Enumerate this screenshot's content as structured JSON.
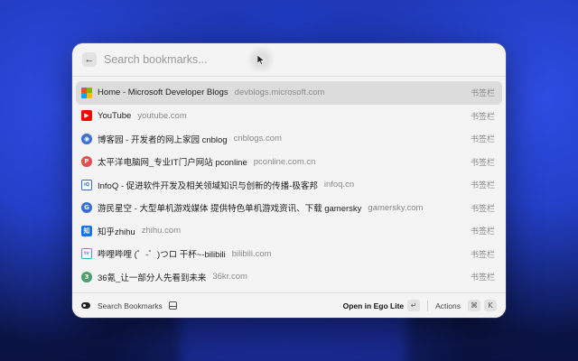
{
  "search": {
    "placeholder": "Search bookmarks..."
  },
  "bookmarks": [
    {
      "title": "Home - Microsoft Developer Blogs",
      "url": "devblogs.microsoft.com",
      "tag": "书签栏",
      "icon": "microsoft-icon",
      "color": "#f25022"
    },
    {
      "title": "YouTube",
      "url": "youtube.com",
      "tag": "书签栏",
      "icon": "youtube-icon",
      "color": "#ff0000"
    },
    {
      "title": "博客园 - 开发者的网上家园 cnblog",
      "url": "cnblogs.com",
      "tag": "书签栏",
      "icon": "cnblogs-icon",
      "color": "#3b6fd4"
    },
    {
      "title": "太平洋电脑网_专业IT门户网站 pconline",
      "url": "pconline.com.cn",
      "tag": "书签栏",
      "icon": "pconline-icon",
      "color": "#e84c4c"
    },
    {
      "title": "InfoQ - 促进软件开发及相关领域知识与创新的传播-极客邦",
      "url": "infoq.cn",
      "tag": "书签栏",
      "icon": "infoq-icon",
      "color": "#2d6fd6"
    },
    {
      "title": "游民星空 - 大型单机游戏媒体 提供特色单机游戏资讯、下载 gamersky",
      "url": "gamersky.com",
      "tag": "书签栏",
      "icon": "gamersky-icon",
      "color": "#3a6cd0"
    },
    {
      "title": "知乎zhihu",
      "url": "zhihu.com",
      "tag": "书签栏",
      "icon": "zhihu-icon",
      "color": "#1772f6"
    },
    {
      "title": "哔哩哔哩 (゜-゜)つロ 干杯~-bilibili",
      "url": "bilibili.com",
      "tag": "书签栏",
      "icon": "bilibili-icon",
      "color": "#23ade5"
    },
    {
      "title": "36氪_让一部分人先看到未来",
      "url": "36kr.com",
      "tag": "书签栏",
      "icon": "36kr-icon",
      "color": "#4aa06a"
    }
  ],
  "footer": {
    "extension_label": "Search Bookmarks",
    "primary_action": "Open in Ego Lite",
    "primary_key": "↵",
    "actions_label": "Actions",
    "actions_key_1": "⌘",
    "actions_key_2": "K"
  }
}
